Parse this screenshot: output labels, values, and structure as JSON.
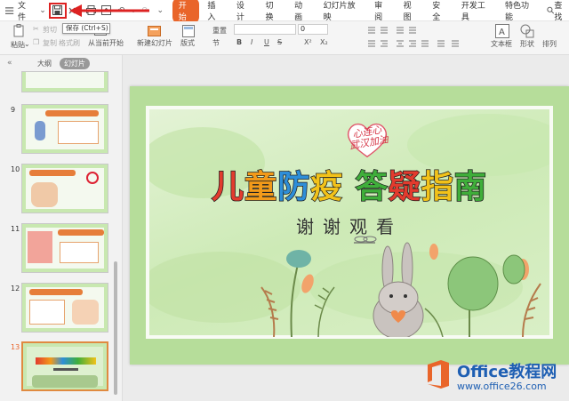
{
  "menubar": {
    "file_label": "文件",
    "tabs": [
      "开始",
      "插入",
      "设计",
      "切换",
      "动画",
      "幻灯片放映",
      "审阅",
      "视图",
      "安全",
      "开发工具",
      "特色功能"
    ],
    "active_tab": 0,
    "search_label": "查找"
  },
  "ribbon": {
    "paste": "粘贴",
    "cut": "剪切",
    "copy": "复制",
    "format_painter": "格式刷",
    "from_current": "从当前开始",
    "new_slide": "新建幻灯片",
    "layout": "版式",
    "section": "节",
    "reset": "重置",
    "font_size": "0",
    "text_box": "文本框",
    "shape": "形状",
    "arrange": "排列",
    "font_buttons": [
      "B",
      "I",
      "U",
      "S",
      "X²",
      "X₂"
    ],
    "accent_color": "#e9652a"
  },
  "tooltip": {
    "text": "保存 (Ctrl+S)"
  },
  "leftpane": {
    "tabs": [
      "大纲",
      "幻灯片"
    ],
    "active_tab": 1,
    "thumbnails": [
      {
        "num": "9"
      },
      {
        "num": "10"
      },
      {
        "num": "11"
      },
      {
        "num": "12"
      },
      {
        "num": "13"
      }
    ]
  },
  "slide": {
    "badge": "心连心\n武汉加油",
    "heading_chars": [
      {
        "char": "儿",
        "color": "#e23b2e"
      },
      {
        "char": "童",
        "color": "#f29a1a"
      },
      {
        "char": "防",
        "color": "#2e8ed8"
      },
      {
        "char": "疫",
        "color": "#f2c21a"
      },
      {
        "char": " ",
        "color": "#000000"
      },
      {
        "char": "答",
        "color": "#3fae3a"
      },
      {
        "char": "疑",
        "color": "#e23b2e"
      },
      {
        "char": "指",
        "color": "#f2c21a"
      },
      {
        "char": "南",
        "color": "#3fae3a"
      }
    ],
    "subtitle": "谢谢观看"
  },
  "watermark": {
    "title": "Office教程网",
    "url": "www.office26.com"
  }
}
